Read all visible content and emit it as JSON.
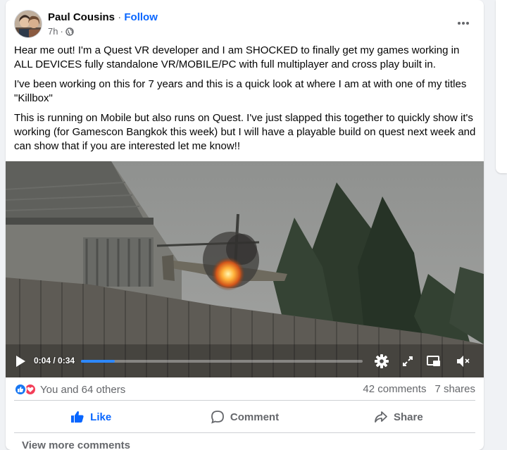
{
  "post": {
    "author": "Paul Cousins",
    "separator": "·",
    "follow_label": "Follow",
    "time": "7h",
    "time_separator": "·",
    "paragraphs": [
      "Hear me out! I'm a Quest VR developer and I am SHOCKED to finally get my games working in ALL DEVICES fully standalone VR/MOBILE/PC with full multiplayer and cross play built in.",
      "I've been working on this for 7 years and this is a quick look at where I am at with one of my titles \"Killbox\"",
      "This is running on Mobile but also runs on Quest. I've just slapped this together to quickly show it's working (for Gamescon Bangkok this week) but I will have a playable build on quest next week and can show that if you are interested let me know!!"
    ]
  },
  "video": {
    "time_display": "0:04 / 0:34",
    "progress": 0.12,
    "icons": [
      "play-icon",
      "settings-icon",
      "fullscreen-icon",
      "miniplayer-icon",
      "mute-icon"
    ]
  },
  "stats": {
    "reactions_text": "You and 64 others",
    "comments": "42 comments",
    "shares": "7 shares",
    "reaction_icons": [
      "like-reaction-icon",
      "love-reaction-icon"
    ]
  },
  "actions": {
    "like": "Like",
    "comment": "Comment",
    "share": "Share"
  },
  "view_more_comments": "View more comments",
  "colors": {
    "accent": "#0866ff",
    "secondary_text": "#65676b",
    "like_reaction": "#1877f2",
    "love_reaction": "#f33e58",
    "progress": "#2d88ff"
  }
}
